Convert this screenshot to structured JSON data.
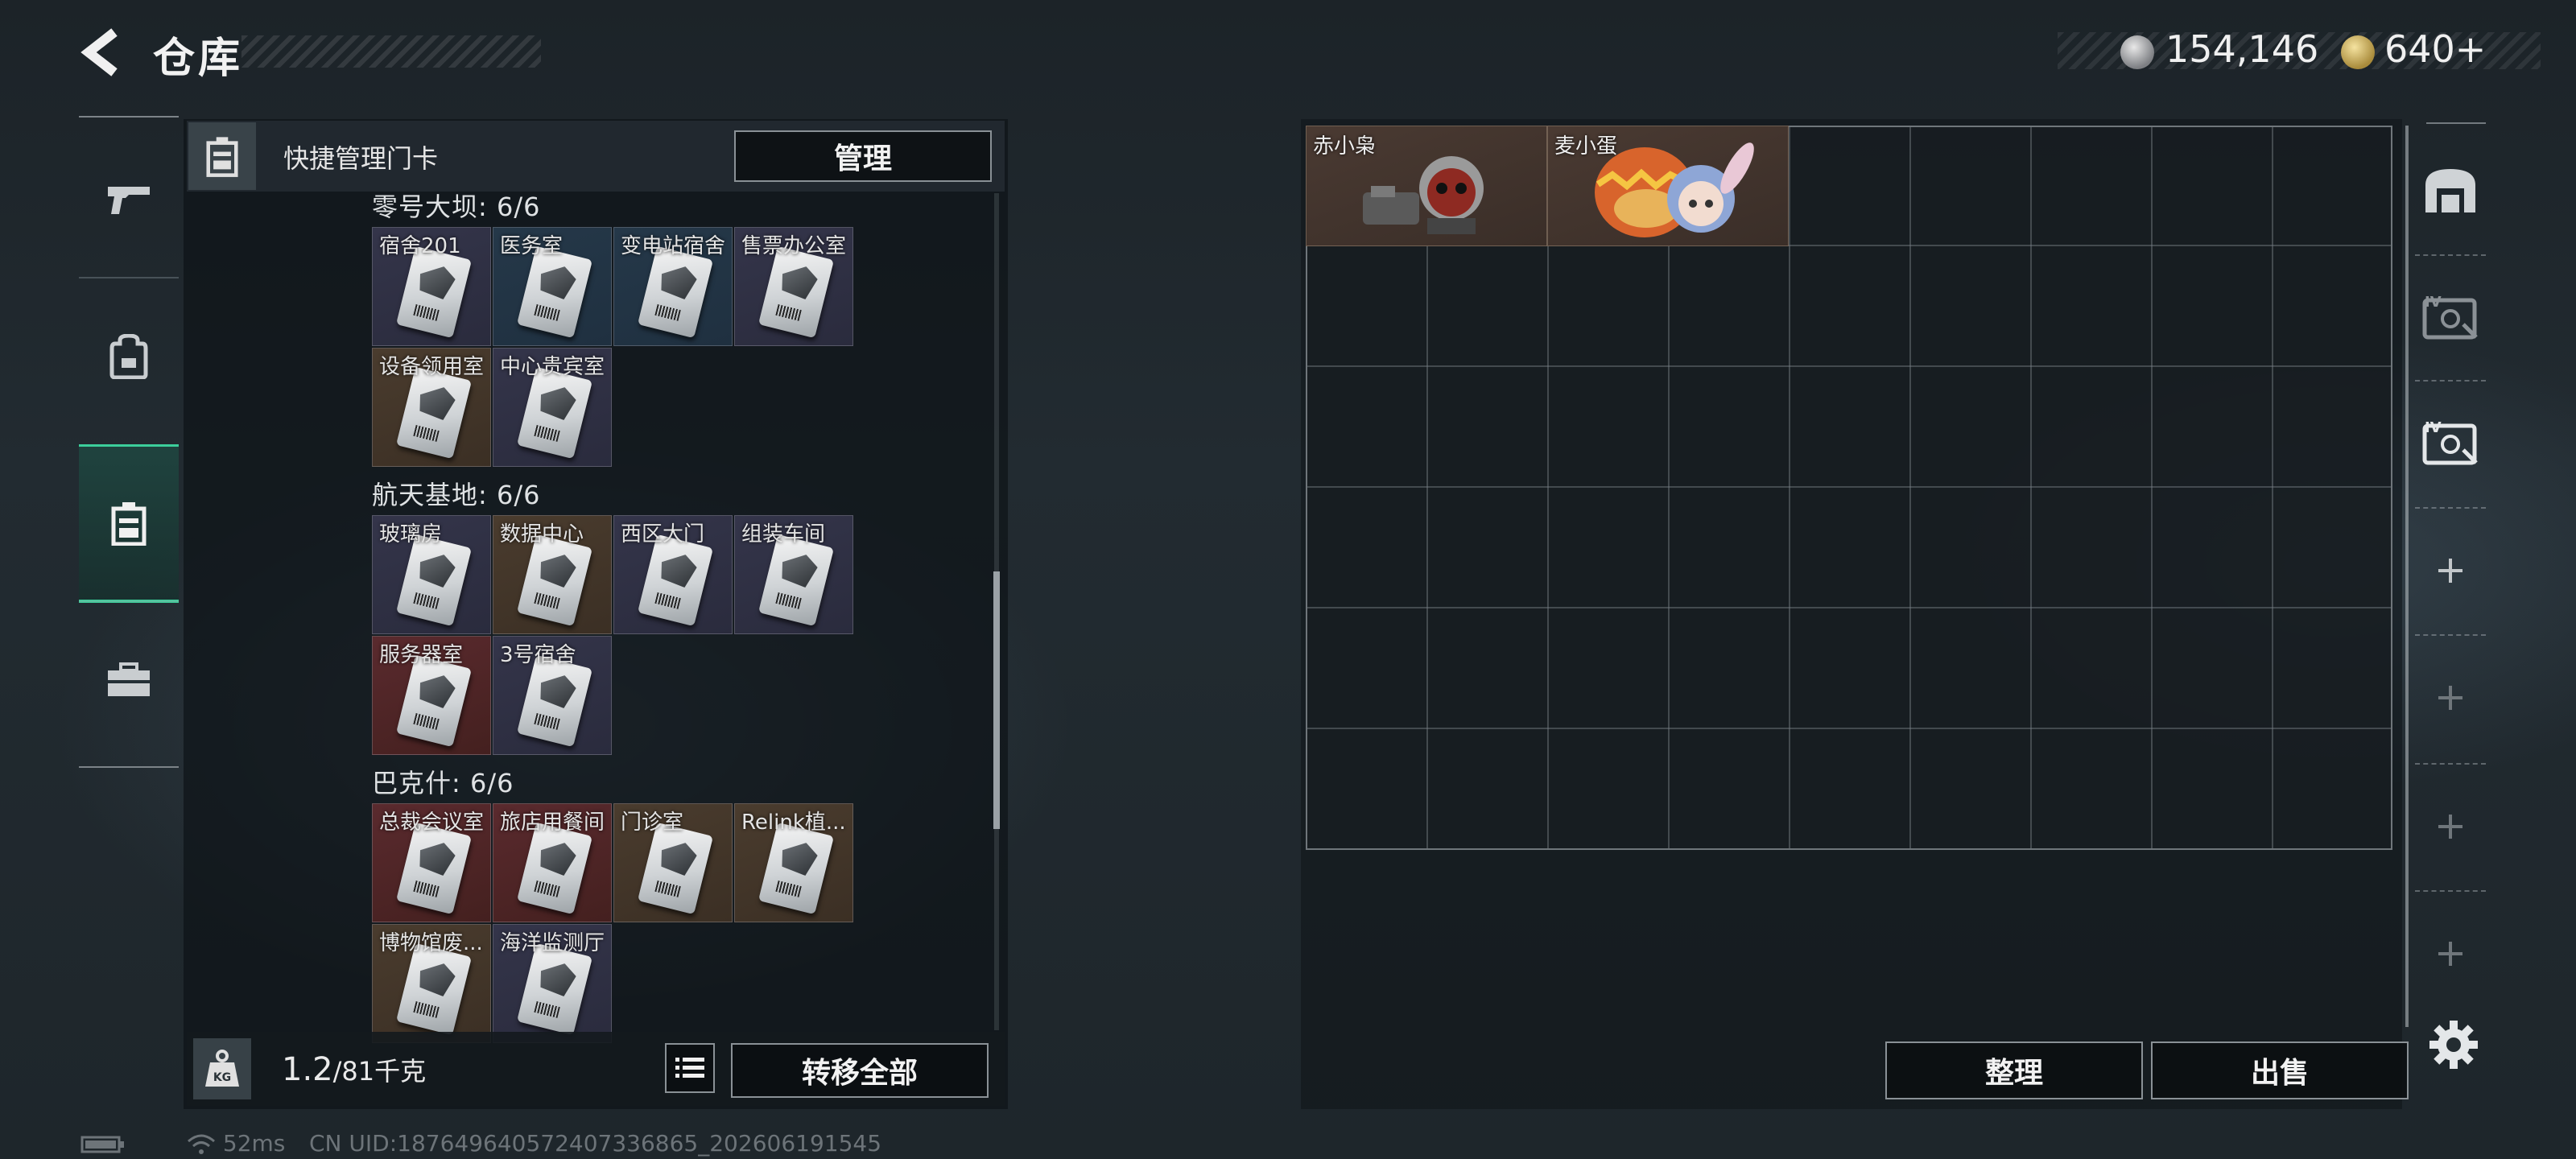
{
  "header": {
    "title": "仓库",
    "back_icon": "chevron-left-icon",
    "currency": [
      {
        "icon": "silver-coin-icon",
        "value": "154,146"
      },
      {
        "icon": "gold-coin-icon",
        "value": "640+"
      }
    ]
  },
  "sidebar": {
    "items": [
      {
        "name": "weapons",
        "icon": "pistol-icon",
        "active": false
      },
      {
        "name": "equipment",
        "icon": "backpack-icon",
        "active": false
      },
      {
        "name": "keycards",
        "icon": "keycard-holder-icon",
        "active": true
      },
      {
        "name": "toolbox",
        "icon": "briefcase-icon",
        "active": false
      }
    ]
  },
  "left_panel": {
    "header_label": "快捷管理门卡",
    "manage_label": "管理",
    "sections": [
      {
        "title": "零号大坝: 6/6",
        "cards": [
          {
            "label": "宿舍201",
            "color": "purple"
          },
          {
            "label": "医务室",
            "color": "blue"
          },
          {
            "label": "变电站宿舍",
            "color": "blue"
          },
          {
            "label": "售票办公室",
            "color": "purple"
          },
          {
            "label": "设备领用室",
            "color": "brown"
          },
          {
            "label": "中心贵宾室",
            "color": "purple"
          }
        ]
      },
      {
        "title": "航天基地: 6/6",
        "cards": [
          {
            "label": "玻璃房",
            "color": "purple"
          },
          {
            "label": "数据中心",
            "color": "brown"
          },
          {
            "label": "西区大门",
            "color": "purple"
          },
          {
            "label": "组装车间",
            "color": "purple"
          },
          {
            "label": "服务器室",
            "color": "red"
          },
          {
            "label": "3号宿舍",
            "color": "purple"
          }
        ]
      },
      {
        "title": "巴克什: 6/6",
        "cards": [
          {
            "label": "总裁会议室",
            "color": "red"
          },
          {
            "label": "旅店用餐间",
            "color": "red"
          },
          {
            "label": "门诊室",
            "color": "brown"
          },
          {
            "label": "Relink植...",
            "color": "brown"
          },
          {
            "label": "博物馆废...",
            "color": "brown"
          },
          {
            "label": "海洋监测厅",
            "color": "purple"
          }
        ]
      }
    ],
    "weight_value": "1.2",
    "weight_capacity": "/81千克",
    "weight_icon_label": "KG",
    "transfer_label": "转移全部"
  },
  "right_panel": {
    "items": [
      {
        "label": "赤小枭"
      },
      {
        "label": "麦小蛋"
      }
    ],
    "sort_label": "整理",
    "sell_label": "出售"
  },
  "status_bar": {
    "ping": "52ms",
    "uid": "CN UID:187649640572407336865_202606191545"
  }
}
